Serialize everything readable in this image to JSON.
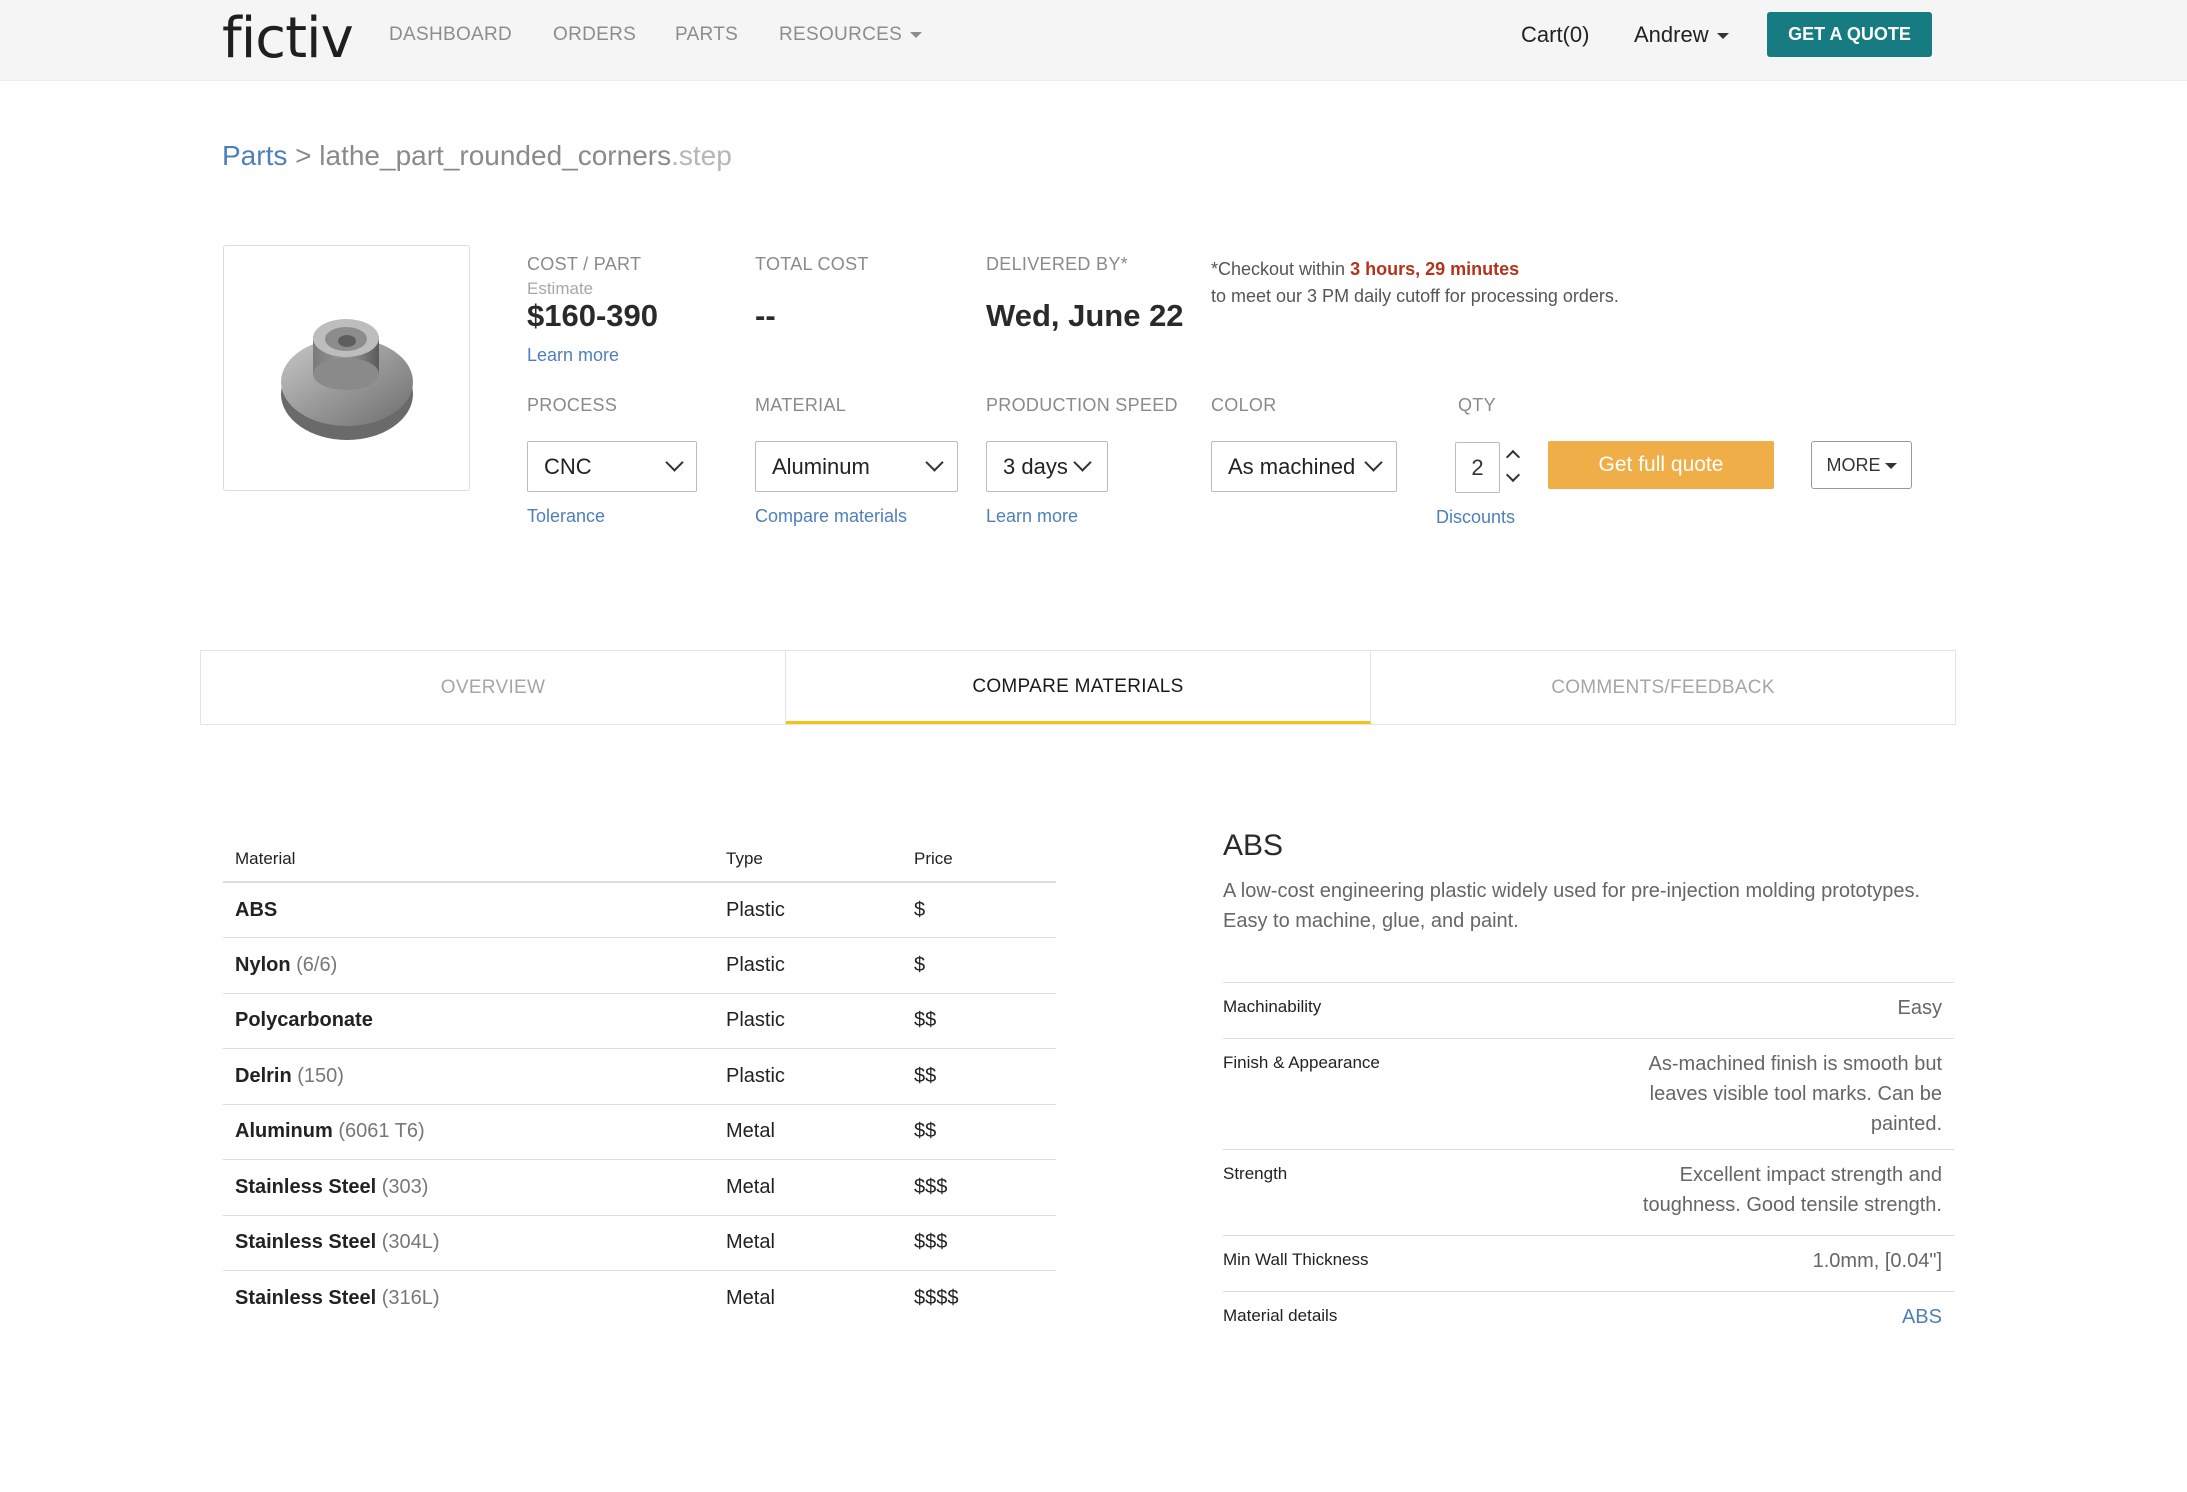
{
  "nav": {
    "logo": "fictiv",
    "links": [
      "DASHBOARD",
      "ORDERS",
      "PARTS",
      "RESOURCES"
    ],
    "cart": "Cart(0)",
    "user": "Andrew",
    "cta": "GET A QUOTE"
  },
  "breadcrumb": {
    "root": "Parts",
    "sep": ">",
    "file": "lathe_part_rounded_corners",
    "ext": ".step"
  },
  "summary": {
    "cost_label": "COST / PART",
    "cost_sub": "Estimate",
    "cost_value": "$160-390",
    "cost_link": "Learn more",
    "total_label": "TOTAL COST",
    "total_value": "--",
    "delivery_label": "DELIVERED BY*",
    "delivery_value": "Wed, June 22",
    "checkout_prefix": "*Checkout within ",
    "checkout_time": "3 hours, 29 minutes",
    "checkout_suffix": "to meet our 3 PM daily cutoff for processing orders."
  },
  "options": {
    "process_label": "PROCESS",
    "process_value": "CNC",
    "process_link": "Tolerance",
    "material_label": "MATERIAL",
    "material_value": "Aluminum",
    "material_link": "Compare materials",
    "speed_label": "PRODUCTION SPEED",
    "speed_value": "3 days",
    "speed_link": "Learn more",
    "color_label": "COLOR",
    "color_value": "As machined",
    "qty_label": "QTY",
    "qty_value": "2",
    "qty_link": "Discounts",
    "full_quote": "Get full quote",
    "more": "MORE"
  },
  "tabs": [
    "OVERVIEW",
    "COMPARE MATERIALS",
    "COMMENTS/FEEDBACK"
  ],
  "materials": {
    "headers": [
      "Material",
      "Type",
      "Price"
    ],
    "rows": [
      {
        "name": "ABS",
        "grade": "",
        "type": "Plastic",
        "price": "$"
      },
      {
        "name": "Nylon",
        "grade": "(6/6)",
        "type": "Plastic",
        "price": "$"
      },
      {
        "name": "Polycarbonate",
        "grade": "",
        "type": "Plastic",
        "price": "$$"
      },
      {
        "name": "Delrin",
        "grade": "(150)",
        "type": "Plastic",
        "price": "$$"
      },
      {
        "name": "Aluminum",
        "grade": "(6061 T6)",
        "type": "Metal",
        "price": "$$"
      },
      {
        "name": "Stainless Steel",
        "grade": "(303)",
        "type": "Metal",
        "price": "$$$"
      },
      {
        "name": "Stainless Steel",
        "grade": "(304L)",
        "type": "Metal",
        "price": "$$$"
      },
      {
        "name": "Stainless Steel",
        "grade": "(316L)",
        "type": "Metal",
        "price": "$$$$"
      }
    ]
  },
  "detail": {
    "title": "ABS",
    "description": "A low-cost engineering plastic widely used for pre-injection molding prototypes. Easy to machine, glue, and paint.",
    "props": [
      {
        "label": "Machinability",
        "value": "Easy"
      },
      {
        "label": "Finish & Appearance",
        "value": "As-machined finish is smooth but leaves visible tool marks. Can be painted."
      },
      {
        "label": "Strength",
        "value": "Excellent impact strength and toughness. Good tensile strength."
      },
      {
        "label": "Min Wall Thickness",
        "value": "1.0mm, [0.04\"]"
      },
      {
        "label": "Material details",
        "value": "ABS"
      }
    ]
  },
  "colors": {
    "brand_teal": "#167c82",
    "accent_yellow": "#f2c514",
    "cta_orange": "#efae48",
    "link_blue": "#4f7fba",
    "warn_red": "#b3341c"
  },
  "icons": [
    "caret-down-icon",
    "chevron-down-icon",
    "chevron-up-icon",
    "part-preview-image"
  ]
}
